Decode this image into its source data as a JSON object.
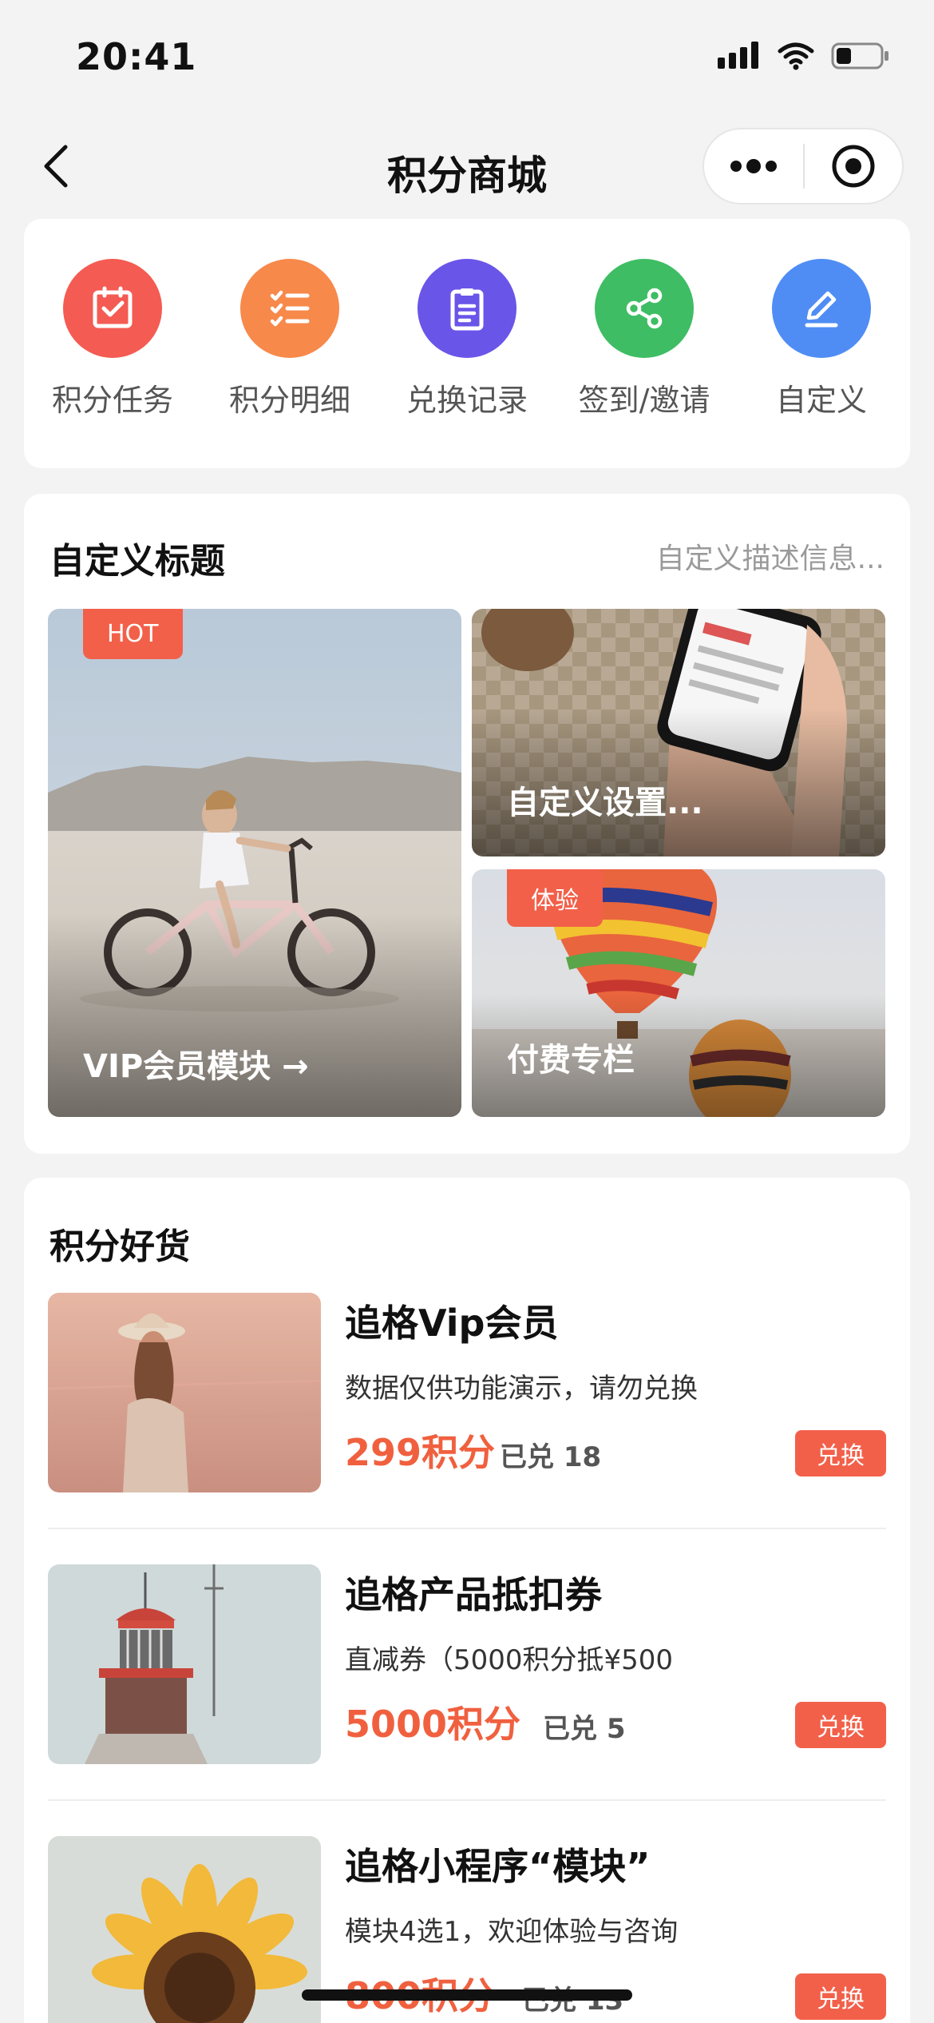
{
  "status_bar": {
    "time": "20:41"
  },
  "nav": {
    "title": "积分商城"
  },
  "shortcuts": [
    {
      "label": "积分任务",
      "icon": "calendar-check-icon",
      "color": "#f45b52"
    },
    {
      "label": "积分明细",
      "icon": "checklist-icon",
      "color": "#f7894b"
    },
    {
      "label": "兑换记录",
      "icon": "clipboard-icon",
      "color": "#6a55e9"
    },
    {
      "label": "签到/邀请",
      "icon": "share-icon",
      "color": "#3fbd64"
    },
    {
      "label": "自定义",
      "icon": "pencil-icon",
      "color": "#4f8df5"
    }
  ],
  "feature_section": {
    "title": "自定义标题",
    "description": "自定义描述信息...",
    "tiles": [
      {
        "label": "VIP会员模块 →",
        "badge": "HOT"
      },
      {
        "label": "自定义设置..."
      },
      {
        "label": "付费专栏",
        "badge": "体验"
      }
    ]
  },
  "goods_section": {
    "title": "积分好货",
    "button_label": "兑换",
    "products": [
      {
        "title": "追格Vip会员",
        "description": "数据仅供功能演示，请勿兑换",
        "price": "299积分",
        "sold": "已兑 18"
      },
      {
        "title": "追格产品抵扣券",
        "description": "直减券（5000积分抵¥500",
        "price": "5000积分",
        "sold": "已兑 5"
      },
      {
        "title": "追格小程序“模块”",
        "description": "模块4选1，欢迎体验与咨询",
        "price": "800积分",
        "sold": "已兑 13"
      }
    ]
  }
}
